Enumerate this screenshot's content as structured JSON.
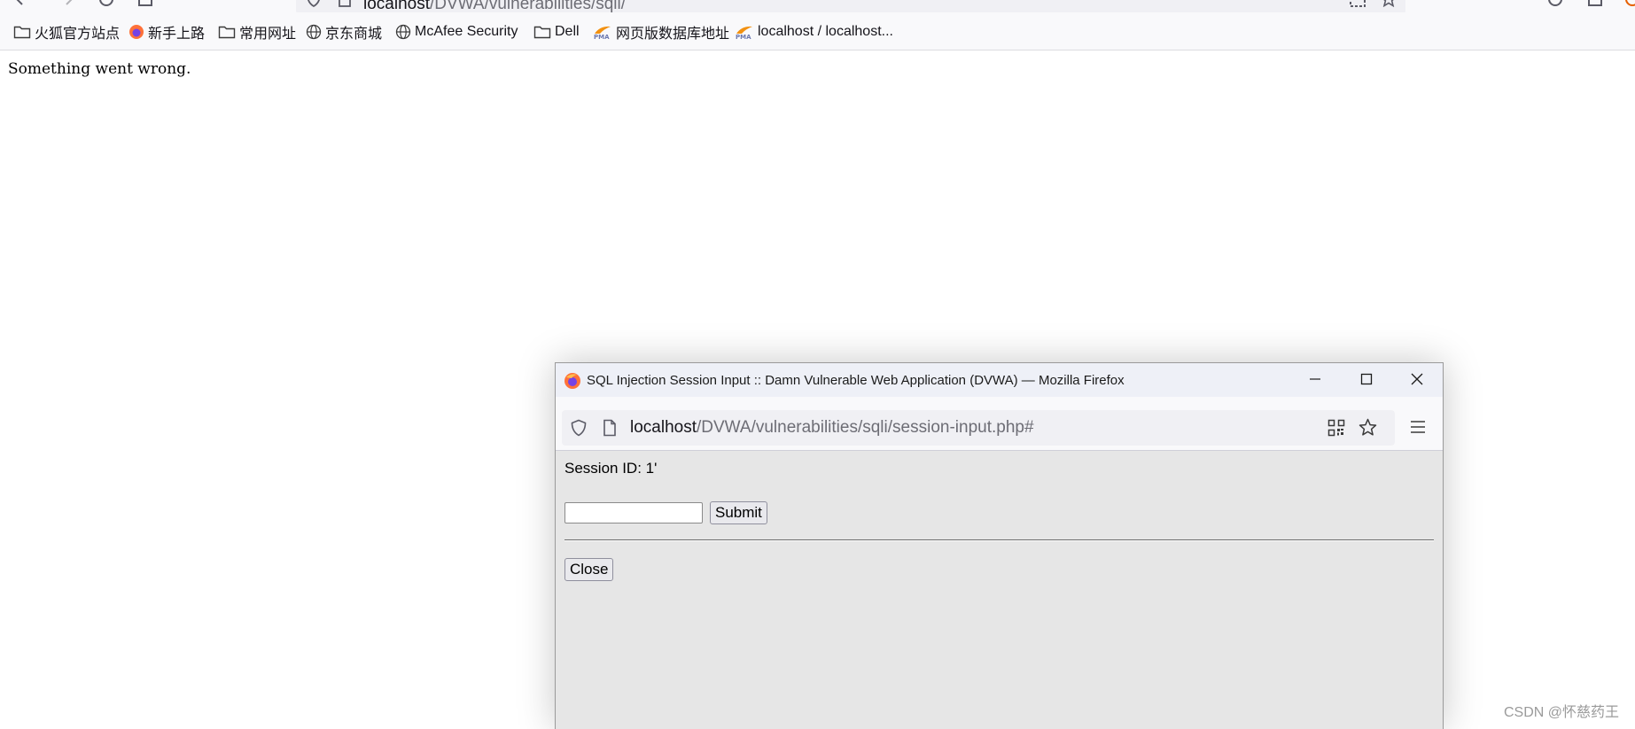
{
  "browser": {
    "url_host": "localhost",
    "url_path": "/DVWA/vulnerabilities/sqli/"
  },
  "bookmarks": [
    {
      "label": "火狐官方站点",
      "icon": "folder-icon"
    },
    {
      "label": "新手上路",
      "icon": "firefox-icon"
    },
    {
      "label": "常用网址",
      "icon": "folder-icon"
    },
    {
      "label": "京东商城",
      "icon": "globe-icon"
    },
    {
      "label": "McAfee Security",
      "icon": "globe-icon"
    },
    {
      "label": "Dell",
      "icon": "folder-icon"
    },
    {
      "label": "网页版数据库地址",
      "icon": "phpmyadmin-icon"
    },
    {
      "label": "localhost / localhost...",
      "icon": "phpmyadmin-icon"
    }
  ],
  "page": {
    "message": "Something went wrong."
  },
  "popup": {
    "title": "SQL Injection Session Input :: Damn Vulnerable Web Application (DVWA) — Mozilla Firefox",
    "url_host": "localhost",
    "url_path": "/DVWA/vulnerabilities/sqli/session-input.php#",
    "session_line": "Session ID: 1'",
    "input_value": "",
    "submit_label": "Submit",
    "close_label": "Close"
  },
  "watermark": "CSDN @怀慈药王",
  "colors": {
    "toolbar_bg": "#f9f9fb",
    "urlbar_bg": "#f0f0f4",
    "popup_bg": "#e6e6e6",
    "popup_titlebar_bg": "#eef0f7"
  }
}
